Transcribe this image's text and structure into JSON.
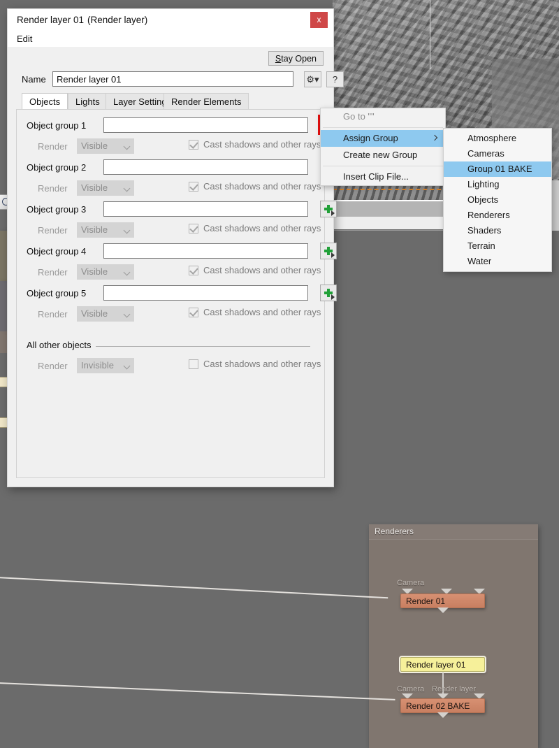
{
  "dialog": {
    "title": "Render layer 01",
    "subtitle": "(Render layer)",
    "close_label": "x",
    "menu": {
      "edit": "Edit"
    },
    "stay_open": "Stay Open",
    "name_label": "Name",
    "name_value": "Render layer 01",
    "gear_icon": "gear-icon",
    "help_label": "?",
    "tabs": [
      {
        "label": "Objects",
        "active": true
      },
      {
        "label": "Lights",
        "active": false
      },
      {
        "label": "Layer Settings",
        "active": false
      },
      {
        "label": "Render Elements",
        "active": false
      }
    ],
    "object_groups": [
      {
        "label": "Object group 1",
        "value": "",
        "render_label": "Render",
        "render_value": "Visible",
        "cast_label": "Cast shadows and other rays",
        "cast_checked": true
      },
      {
        "label": "Object group 2",
        "value": "",
        "render_label": "Render",
        "render_value": "Visible",
        "cast_label": "Cast shadows and other rays",
        "cast_checked": true
      },
      {
        "label": "Object group 3",
        "value": "",
        "render_label": "Render",
        "render_value": "Visible",
        "cast_label": "Cast shadows and other rays",
        "cast_checked": true
      },
      {
        "label": "Object group 4",
        "value": "",
        "render_label": "Render",
        "render_value": "Visible",
        "cast_label": "Cast shadows and other rays",
        "cast_checked": true
      },
      {
        "label": "Object group 5",
        "value": "",
        "render_label": "Render",
        "render_value": "Visible",
        "cast_label": "Cast shadows and other rays",
        "cast_checked": true
      }
    ],
    "all_other": {
      "label": "All other objects",
      "render_label": "Render",
      "render_value": "Invisible",
      "cast_label": "Cast shadows and other rays",
      "cast_checked": false
    }
  },
  "context_menu": {
    "items": [
      {
        "label": "Go to \"\"",
        "disabled": true,
        "highlight": false,
        "submenu": false
      },
      {
        "label": "Assign Group",
        "disabled": false,
        "highlight": true,
        "submenu": true
      },
      {
        "label": "Create new Group",
        "disabled": false,
        "highlight": false,
        "submenu": false
      },
      {
        "label": "Insert Clip File...",
        "disabled": false,
        "highlight": false,
        "submenu": false
      }
    ]
  },
  "submenu": {
    "items": [
      {
        "label": "Atmosphere",
        "highlight": false
      },
      {
        "label": "Cameras",
        "highlight": false
      },
      {
        "label": "Group 01 BAKE",
        "highlight": true
      },
      {
        "label": "Lighting",
        "highlight": false
      },
      {
        "label": "Objects",
        "highlight": false
      },
      {
        "label": "Renderers",
        "highlight": false
      },
      {
        "label": "Shaders",
        "highlight": false
      },
      {
        "label": "Terrain",
        "highlight": false
      },
      {
        "label": "Water",
        "highlight": false
      }
    ]
  },
  "node_graph": {
    "groups": [
      {
        "title": "Renderers"
      }
    ],
    "nodes": [
      {
        "label": "Render 01",
        "type": "render"
      },
      {
        "label": "Render layer 01",
        "type": "layer"
      },
      {
        "label": "Render 02 BAKE",
        "type": "render"
      }
    ],
    "port_labels": {
      "camera_top": "Camera",
      "camera_bottom": "Camera",
      "render_layer": "Render layer"
    }
  },
  "colors": {
    "accent_highlight": "#8ec9ef",
    "close_button": "#cf4747",
    "highlight_border": "#e81010",
    "plus_green": "#21a038",
    "node_render": "#c87f61",
    "node_layer": "#f6f09a",
    "crop_marquee": "#e08a33"
  }
}
